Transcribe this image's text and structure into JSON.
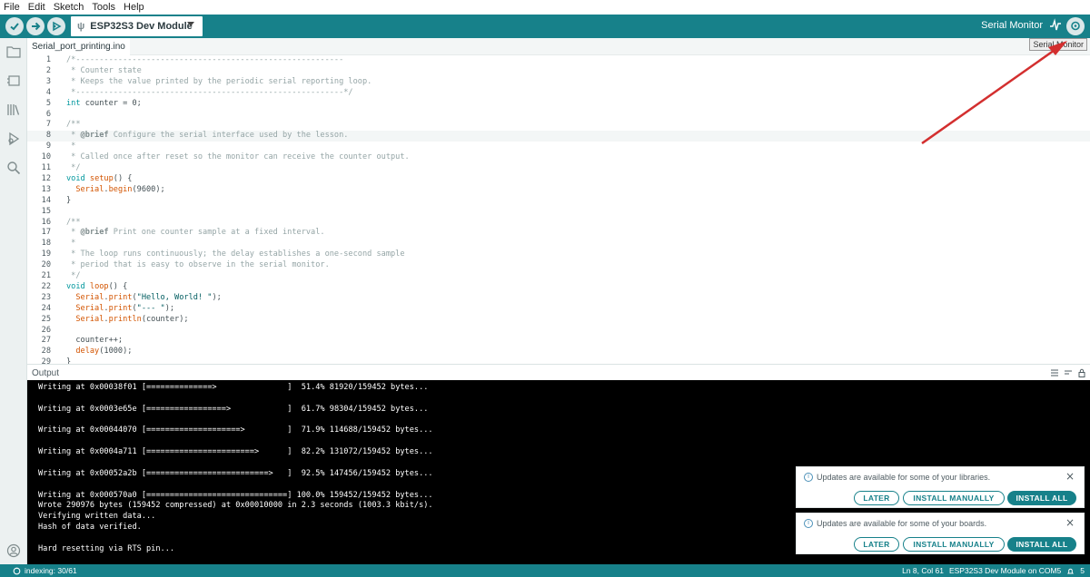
{
  "menu": [
    "File",
    "Edit",
    "Sketch",
    "Tools",
    "Help"
  ],
  "toolbar": {
    "board_name": "ESP32S3 Dev Module",
    "serial_monitor_label": "Serial Monitor",
    "tooltip": "Serial Monitor"
  },
  "tab": {
    "filename": "Serial_port_printing.ino"
  },
  "code_lines": [
    {
      "n": "1",
      "parts": [
        {
          "c": "com",
          "t": "/*---------------------------------------------------------"
        }
      ]
    },
    {
      "n": "2",
      "parts": [
        {
          "c": "com",
          "t": " * Counter state"
        }
      ]
    },
    {
      "n": "3",
      "parts": [
        {
          "c": "com",
          "t": " * Keeps the value printed by the periodic serial reporting loop."
        }
      ]
    },
    {
      "n": "4",
      "parts": [
        {
          "c": "com",
          "t": " *---------------------------------------------------------*/"
        }
      ]
    },
    {
      "n": "5",
      "parts": [
        {
          "c": "kw",
          "t": "int"
        },
        {
          "c": "txt",
          "t": " counter = 0;"
        }
      ]
    },
    {
      "n": "6",
      "parts": []
    },
    {
      "n": "7",
      "parts": [
        {
          "c": "com",
          "t": "/**"
        }
      ]
    },
    {
      "n": "8",
      "parts": [
        {
          "c": "com",
          "t": " * "
        },
        {
          "c": "doc",
          "t": "@brief"
        },
        {
          "c": "com",
          "t": " Configure the serial interface used by the lesson."
        }
      ],
      "active": true
    },
    {
      "n": "9",
      "parts": [
        {
          "c": "com",
          "t": " *"
        }
      ]
    },
    {
      "n": "10",
      "parts": [
        {
          "c": "com",
          "t": " * Called once after reset so the monitor can receive the counter output."
        }
      ]
    },
    {
      "n": "11",
      "parts": [
        {
          "c": "com",
          "t": " */"
        }
      ]
    },
    {
      "n": "12",
      "parts": [
        {
          "c": "kw",
          "t": "void"
        },
        {
          "c": "txt",
          "t": " "
        },
        {
          "c": "fn",
          "t": "setup"
        },
        {
          "c": "txt",
          "t": "() {"
        }
      ]
    },
    {
      "n": "13",
      "parts": [
        {
          "c": "txt",
          "t": "  "
        },
        {
          "c": "fn",
          "t": "Serial"
        },
        {
          "c": "txt",
          "t": "."
        },
        {
          "c": "fn",
          "t": "begin"
        },
        {
          "c": "txt",
          "t": "(9600);"
        }
      ]
    },
    {
      "n": "14",
      "parts": [
        {
          "c": "txt",
          "t": "}"
        }
      ]
    },
    {
      "n": "15",
      "parts": []
    },
    {
      "n": "16",
      "parts": [
        {
          "c": "com",
          "t": "/**"
        }
      ]
    },
    {
      "n": "17",
      "parts": [
        {
          "c": "com",
          "t": " * "
        },
        {
          "c": "doc",
          "t": "@brief"
        },
        {
          "c": "com",
          "t": " Print one counter sample at a fixed interval."
        }
      ]
    },
    {
      "n": "18",
      "parts": [
        {
          "c": "com",
          "t": " *"
        }
      ]
    },
    {
      "n": "19",
      "parts": [
        {
          "c": "com",
          "t": " * The loop runs continuously; the delay establishes a one-second sample"
        }
      ]
    },
    {
      "n": "20",
      "parts": [
        {
          "c": "com",
          "t": " * period that is easy to observe in the serial monitor."
        }
      ]
    },
    {
      "n": "21",
      "parts": [
        {
          "c": "com",
          "t": " */"
        }
      ]
    },
    {
      "n": "22",
      "parts": [
        {
          "c": "kw",
          "t": "void"
        },
        {
          "c": "txt",
          "t": " "
        },
        {
          "c": "fn",
          "t": "loop"
        },
        {
          "c": "txt",
          "t": "() {"
        }
      ]
    },
    {
      "n": "23",
      "parts": [
        {
          "c": "txt",
          "t": "  "
        },
        {
          "c": "fn",
          "t": "Serial"
        },
        {
          "c": "txt",
          "t": "."
        },
        {
          "c": "fn",
          "t": "print"
        },
        {
          "c": "txt",
          "t": "("
        },
        {
          "c": "str",
          "t": "\"Hello, World! \""
        },
        {
          "c": "txt",
          "t": ");"
        }
      ]
    },
    {
      "n": "24",
      "parts": [
        {
          "c": "txt",
          "t": "  "
        },
        {
          "c": "fn",
          "t": "Serial"
        },
        {
          "c": "txt",
          "t": "."
        },
        {
          "c": "fn",
          "t": "print"
        },
        {
          "c": "txt",
          "t": "("
        },
        {
          "c": "str",
          "t": "\"--- \""
        },
        {
          "c": "txt",
          "t": ");"
        }
      ]
    },
    {
      "n": "25",
      "parts": [
        {
          "c": "txt",
          "t": "  "
        },
        {
          "c": "fn",
          "t": "Serial"
        },
        {
          "c": "txt",
          "t": "."
        },
        {
          "c": "fn",
          "t": "println"
        },
        {
          "c": "txt",
          "t": "(counter);"
        }
      ]
    },
    {
      "n": "26",
      "parts": []
    },
    {
      "n": "27",
      "parts": [
        {
          "c": "txt",
          "t": "  counter++;"
        }
      ]
    },
    {
      "n": "28",
      "parts": [
        {
          "c": "txt",
          "t": "  "
        },
        {
          "c": "fn",
          "t": "delay"
        },
        {
          "c": "txt",
          "t": "(1000);"
        }
      ]
    },
    {
      "n": "29",
      "parts": [
        {
          "c": "txt",
          "t": "}"
        }
      ]
    }
  ],
  "output": {
    "title": "Output",
    "lines": [
      "Writing at 0x00038f01 [==============>               ]  51.4% 81920/159452 bytes...",
      "",
      "Writing at 0x0003e65e [=================>            ]  61.7% 98304/159452 bytes...",
      "",
      "Writing at 0x00044070 [====================>         ]  71.9% 114688/159452 bytes...",
      "",
      "Writing at 0x0004a711 [=======================>      ]  82.2% 131072/159452 bytes...",
      "",
      "Writing at 0x00052a2b [==========================>   ]  92.5% 147456/159452 bytes...",
      "",
      "Writing at 0x000570a0 [==============================] 100.0% 159452/159452 bytes...",
      "Wrote 290976 bytes (159452 compressed) at 0x00010000 in 2.3 seconds (1003.3 kbit/s).",
      "Verifying written data...",
      "Hash of data verified.",
      "",
      "Hard resetting via RTS pin..."
    ]
  },
  "notifications": [
    {
      "message": "Updates are available for some of your libraries.",
      "later": "LATER",
      "manual": "INSTALL MANUALLY",
      "all": "INSTALL ALL"
    },
    {
      "message": "Updates are available for some of your boards.",
      "later": "LATER",
      "manual": "INSTALL MANUALLY",
      "all": "INSTALL ALL"
    }
  ],
  "status": {
    "indexing": "indexing: 30/61",
    "cursor": "Ln 8, Col 61",
    "board_port": "ESP32S3 Dev Module on COM5",
    "notif_count": "5"
  },
  "colors": {
    "accent": "#17818a",
    "output_bg": "#000000",
    "arrow": "#d32f2f"
  }
}
